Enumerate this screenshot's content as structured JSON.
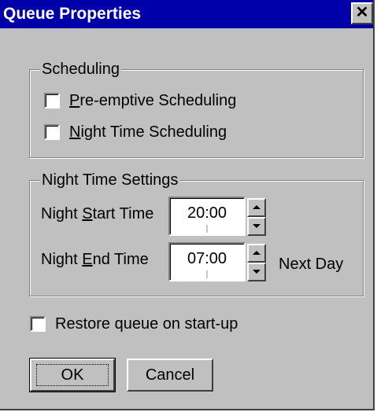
{
  "window": {
    "title": "Queue Properties",
    "close_glyph": "✕"
  },
  "scheduling": {
    "legend": "Scheduling",
    "preemptive": {
      "mnemonic": "P",
      "rest": "re-emptive Scheduling",
      "checked": false
    },
    "night_time": {
      "mnemonic": "N",
      "rest": "ight Time Scheduling",
      "checked": false
    }
  },
  "night_settings": {
    "legend": "Night Time Settings",
    "start": {
      "label_before": "Night ",
      "mnemonic": "S",
      "label_after": "tart Time",
      "value": "20:00"
    },
    "end": {
      "label_before": "Night ",
      "mnemonic": "E",
      "label_after": "nd Time",
      "value": "07:00",
      "suffix": "Next Day"
    }
  },
  "restore": {
    "label": "Restore queue on start-up",
    "checked": false
  },
  "buttons": {
    "ok": "OK",
    "cancel": "Cancel"
  },
  "colors": {
    "titlebar": "#0000a8",
    "face": "#c0c0c0"
  }
}
